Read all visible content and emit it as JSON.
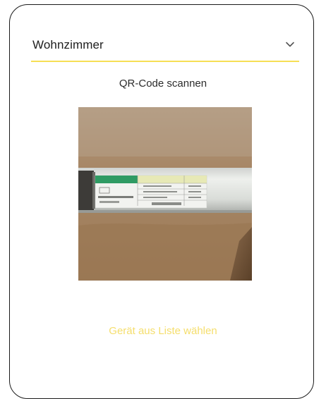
{
  "room_select": {
    "selected": "Wohnzimmer",
    "icon": "chevron-down-icon"
  },
  "scanner": {
    "title": "QR-Code scannen"
  },
  "actions": {
    "choose_from_list": "Gerät aus Liste wählen"
  },
  "colors": {
    "accent": "#f6df55",
    "link": "#f5de6c",
    "text": "#1e1e1e"
  }
}
